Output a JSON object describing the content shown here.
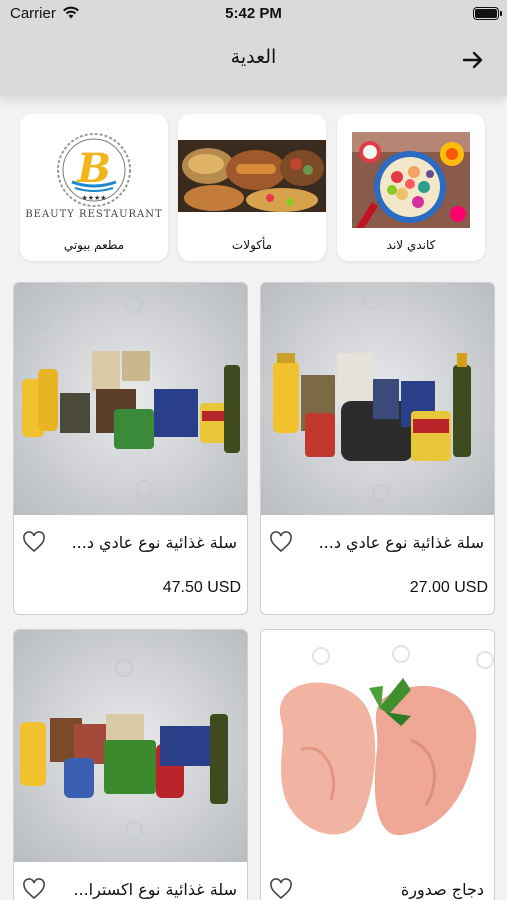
{
  "status": {
    "carrier": "Carrier",
    "time": "5:42 PM"
  },
  "header": {
    "title": "العدية"
  },
  "categories": [
    {
      "label": "كاندي لاند",
      "icon": "candy-image"
    },
    {
      "label": "مأكولات",
      "icon": "food-platter-image"
    },
    {
      "label": "مطعم بيوتي",
      "icon": "beauty-restaurant-logo",
      "logo_text": "Beauty Restaurant"
    }
  ],
  "products": [
    {
      "name": "سلة غذائية نوع عادي د...",
      "price": "27.00 USD"
    },
    {
      "name": "سلة غذائية نوع عادي د...",
      "price": "47.50 USD"
    },
    {
      "name": "دجاج صدورة",
      "price": ""
    },
    {
      "name": "سلة غذائية نوع اكسترا...",
      "price": ""
    }
  ],
  "colors": {
    "header_bg": "#dadada",
    "card_bg": "#ffffff",
    "page_bg": "#f2f2f2"
  }
}
